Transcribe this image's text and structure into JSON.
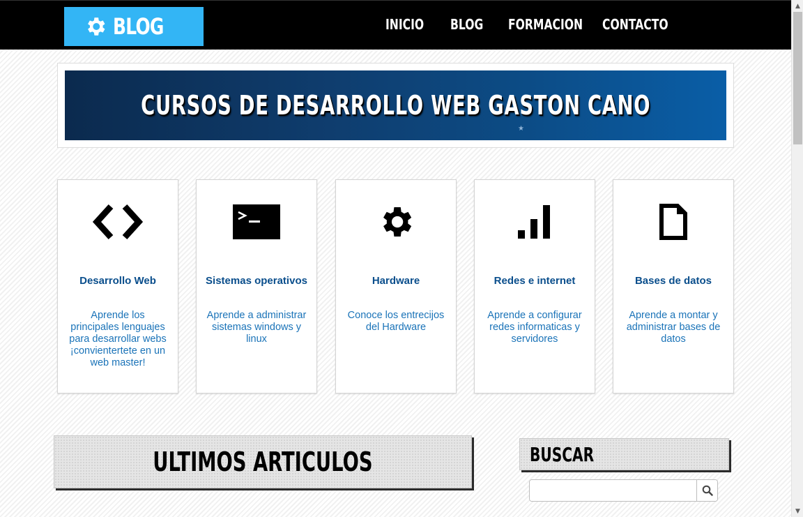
{
  "header": {
    "logo_text": "BLOG",
    "nav": [
      {
        "label": "INICIO"
      },
      {
        "label": "BLOG"
      },
      {
        "label": "FORMACION"
      },
      {
        "label": "CONTACTO"
      }
    ]
  },
  "banner": {
    "title": "CURSOS DE DESARROLLO WEB GASTON CANO"
  },
  "cards": [
    {
      "icon": "code-icon",
      "title": "Desarrollo Web",
      "description": "Aprende los principales lenguajes para desarrollar webs ¡convientertete en un web master!"
    },
    {
      "icon": "terminal-icon",
      "title": "Sistemas operativos",
      "description": "Aprende a administrar sistemas windows y linux"
    },
    {
      "icon": "gear-icon",
      "title": "Hardware",
      "description": "Conoce los entrecijos del Hardware"
    },
    {
      "icon": "signal-bars-icon",
      "title": "Redes e internet",
      "description": "Aprende a configurar redes informaticas y servidores"
    },
    {
      "icon": "document-icon",
      "title": "Bases de datos",
      "description": "Aprende a montar y administrar bases de datos"
    }
  ],
  "articles": {
    "title": "ULTIMOS ARTICULOS"
  },
  "search": {
    "title": "BUSCAR",
    "value": "",
    "button_icon": "search-icon"
  },
  "colors": {
    "header_bg": "#000000",
    "logo_bg": "#33b5f5",
    "card_title": "#0a4e8c",
    "card_desc": "#1a73b8"
  }
}
